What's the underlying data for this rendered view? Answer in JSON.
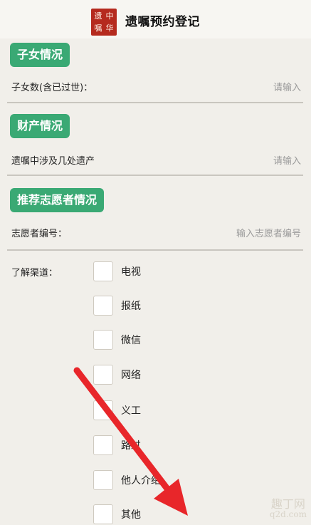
{
  "header": {
    "logo_chars": [
      "中",
      "遗",
      "华",
      "嘱"
    ],
    "title": "遗嘱预约登记"
  },
  "sections": {
    "children": {
      "title": "子女情况",
      "field_label": "子女数(含已过世)：",
      "field_placeholder": "请输入"
    },
    "property": {
      "title": "财产情况",
      "field_label": "遗嘱中涉及几处遗产",
      "field_placeholder": "请输入"
    },
    "volunteer": {
      "title": "推荐志愿者情况",
      "field_label": "志愿者编号：",
      "field_placeholder": "输入志愿者编号"
    }
  },
  "channels": {
    "label": "了解渠道：",
    "options": [
      "电视",
      "报纸",
      "微信",
      "网络",
      "义工",
      "路过",
      "他人介绍",
      "其他"
    ]
  },
  "annotation": {
    "arrow_color": "#e8262a"
  },
  "watermark": {
    "line1": "趣丁网",
    "line2": "q2d.com"
  }
}
